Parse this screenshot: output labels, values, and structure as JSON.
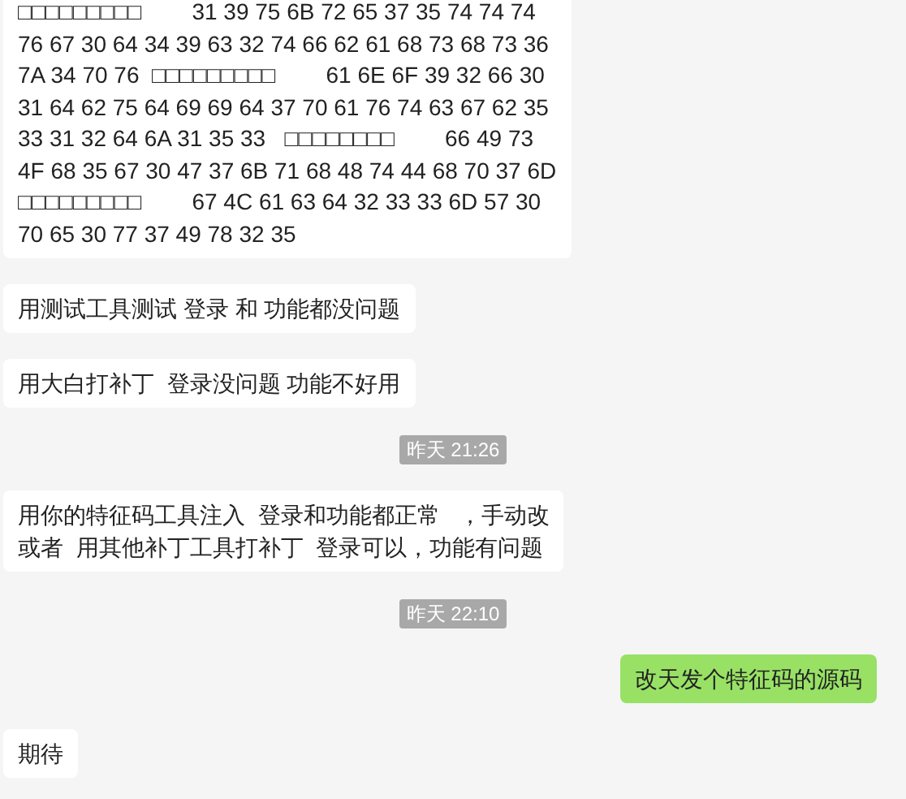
{
  "messages": [
    {
      "kind": "message",
      "outgoing": false,
      "lines": [
        "□□□□□□□□□        31 39 75 6B 72 65 37 35 74 74 74",
        "76 67 30 64 34 39 63 32 74 66 62 61 68 73 68 73 36",
        "7A 34 70 76  □□□□□□□□□        61 6E 6F 39 32 66 30",
        "31 64 62 75 64 69 69 64 37 70 61 76 74 63 67 62 35",
        "33 31 32 64 6A 31 35 33   □□□□□□□□        66 49 73",
        "4F 68 35 67 30 47 37 6B 71 68 48 74 44 68 70 37 6D",
        "□□□□□□□□□        67 4C 61 63 64 32 33 33 6D 57 30",
        "70 65 30 77 37 49 78 32 35"
      ]
    },
    {
      "kind": "message",
      "outgoing": false,
      "lines": [
        "用测试工具测试 登录 和 功能都没问题"
      ]
    },
    {
      "kind": "message",
      "outgoing": false,
      "lines": [
        "用大白打补丁  登录没问题 功能不好用"
      ]
    },
    {
      "kind": "time",
      "text": "昨天 21:26"
    },
    {
      "kind": "message",
      "outgoing": false,
      "lines": [
        "用你的特征码工具注入  登录和功能都正常   ，手动改",
        "或者  用其他补丁工具打补丁  登录可以，功能有问题"
      ]
    },
    {
      "kind": "time",
      "text": "昨天 22:10"
    },
    {
      "kind": "message",
      "outgoing": true,
      "lines": [
        "改天发个特征码的源码"
      ]
    },
    {
      "kind": "message",
      "outgoing": false,
      "lines": [
        "期待"
      ]
    }
  ]
}
